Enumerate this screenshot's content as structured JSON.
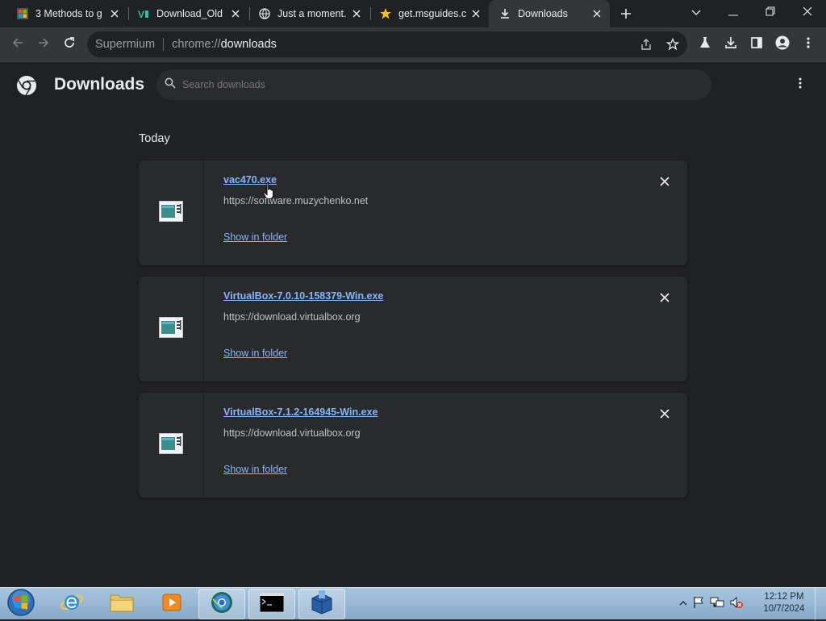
{
  "browser": {
    "tabs": [
      {
        "title": "3 Methods to g",
        "favicon": "ms-logo-icon",
        "active": false
      },
      {
        "title": "Download_Old",
        "favicon": "vb-icon",
        "active": false
      },
      {
        "title": "Just a moment.",
        "favicon": "globe-icon",
        "active": false
      },
      {
        "title": "get.msguides.c",
        "favicon": "star-icon",
        "active": false
      },
      {
        "title": "Downloads",
        "favicon": "download-icon",
        "active": true
      }
    ],
    "omnibox": {
      "label": "Supermium",
      "scheme": "chrome://",
      "host": "downloads"
    }
  },
  "page": {
    "title": "Downloads",
    "search_placeholder": "Search downloads",
    "section_label": "Today",
    "downloads": [
      {
        "file_name": "vac470.exe",
        "url": "https://software.muzychenko.net",
        "action": "Show in folder"
      },
      {
        "file_name": "VirtualBox-7.0.10-158379-Win.exe",
        "url": "https://download.virtualbox.org",
        "action": "Show in folder"
      },
      {
        "file_name": "VirtualBox-7.1.2-164945-Win.exe",
        "url": "https://download.virtualbox.org",
        "action": "Show in folder"
      }
    ]
  },
  "taskbar": {
    "clock_time": "12:12 PM",
    "clock_date": "10/7/2024"
  },
  "colors": {
    "accent_link": "#8ab4f8",
    "card_bg": "#292a2d",
    "page_bg": "#202124"
  }
}
